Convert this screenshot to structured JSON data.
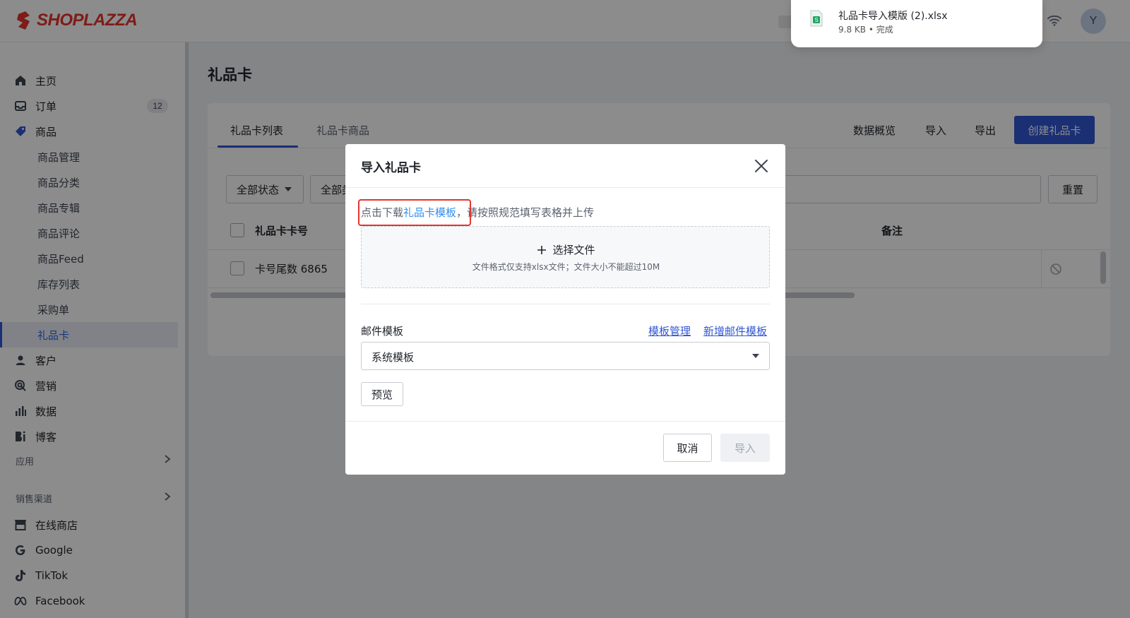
{
  "brand": {
    "name": "SHOPLAZZA",
    "color": "#e5342c"
  },
  "user": {
    "initial": "Y"
  },
  "download": {
    "file_name": "礼品卡导入模版 (2).xlsx",
    "meta": "9.8 KB • 完成"
  },
  "sidebar": {
    "items": [
      {
        "label": "主页",
        "icon": "home-icon"
      },
      {
        "label": "订单",
        "icon": "inbox-icon",
        "badge": "12"
      },
      {
        "label": "商品",
        "icon": "tag-icon"
      }
    ],
    "sub_items": [
      "商品管理",
      "商品分类",
      "商品专辑",
      "商品评论",
      "商品Feed",
      "库存列表",
      "采购单",
      "礼品卡"
    ],
    "items2": [
      {
        "label": "客户",
        "icon": "user-icon"
      },
      {
        "label": "营销",
        "icon": "marketing-icon"
      },
      {
        "label": "数据",
        "icon": "bar-chart-icon"
      },
      {
        "label": "博客",
        "icon": "blog-icon"
      }
    ],
    "section_apps": "应用",
    "section_channels": "销售渠道",
    "channels": [
      {
        "label": "在线商店",
        "icon": "store-icon"
      },
      {
        "label": "Google",
        "icon": "google-icon"
      },
      {
        "label": "TikTok",
        "icon": "tiktok-icon"
      },
      {
        "label": "Facebook",
        "icon": "meta-icon"
      }
    ]
  },
  "page": {
    "title": "礼品卡",
    "tabs": [
      "礼品卡列表",
      "礼品卡商品"
    ],
    "actions": [
      "数据概览",
      "导入",
      "导出"
    ],
    "create_button": "创建礼品卡",
    "filters": {
      "status": "全部状态",
      "type": "全部类"
    },
    "reset_button": "重置",
    "table": {
      "headers": {
        "card_no": "礼品卡卡号",
        "note": "备注"
      },
      "rows": [
        {
          "card_no": "卡号尾数 6865"
        }
      ]
    }
  },
  "modal": {
    "title": "导入礼品卡",
    "hint_prefix": "点击下载",
    "hint_link": "礼品卡模板",
    "hint_suffix": "，请按照规范填写表格并上传",
    "upload_label": "选择文件",
    "upload_hint": "文件格式仅支持xlsx文件；文件大小不能超过10M",
    "email_label": "邮件模板",
    "link_manage": "模板管理",
    "link_add": "新增邮件模板",
    "email_select_value": "系统模板",
    "preview_button": "预览",
    "cancel_button": "取消",
    "import_button": "导入"
  }
}
